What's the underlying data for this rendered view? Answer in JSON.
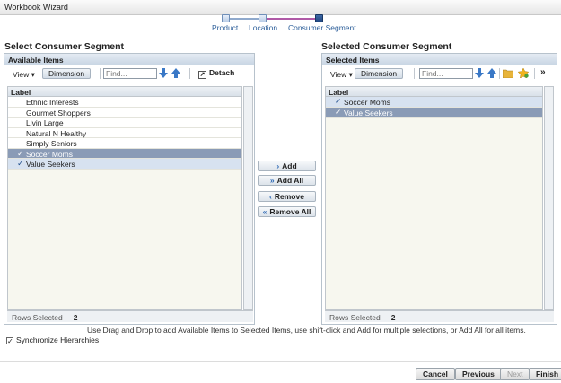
{
  "window": {
    "title": "Workbook Wizard"
  },
  "train": {
    "steps": [
      {
        "label": "Product"
      },
      {
        "label": "Location"
      },
      {
        "label": "Consumer Segment"
      }
    ],
    "current_index": 2
  },
  "left": {
    "section_title": "Select Consumer Segment",
    "panel_title": "Available Items",
    "toolbar": {
      "view_label": "View",
      "dimension_label": "Dimension",
      "find_placeholder": "Find...",
      "detach_label": "Detach"
    },
    "column_header": "Label",
    "items": [
      {
        "label": "Ethnic Interests",
        "checked": false,
        "state": "normal"
      },
      {
        "label": "Gourmet Shoppers",
        "checked": false,
        "state": "normal"
      },
      {
        "label": "Livin Large",
        "checked": false,
        "state": "normal"
      },
      {
        "label": "Natural N Healthy",
        "checked": false,
        "state": "normal"
      },
      {
        "label": "Simply Seniors",
        "checked": false,
        "state": "normal"
      },
      {
        "label": "Soccer Moms",
        "checked": true,
        "state": "selected"
      },
      {
        "label": "Value Seekers",
        "checked": true,
        "state": "highlight"
      }
    ],
    "rows_selected_label": "Rows Selected",
    "rows_selected_count": "2"
  },
  "shuttle": {
    "add": "Add",
    "add_all": "Add All",
    "remove": "Remove",
    "remove_all": "Remove All"
  },
  "right": {
    "section_title": "Selected Consumer Segment",
    "panel_title": "Selected Items",
    "toolbar": {
      "view_label": "View",
      "dimension_label": "Dimension",
      "find_placeholder": "Find...",
      "more_label": "»"
    },
    "column_header": "Label",
    "items": [
      {
        "label": "Soccer Moms",
        "checked": true,
        "state": "highlight"
      },
      {
        "label": "Value Seekers",
        "checked": true,
        "state": "selected"
      }
    ],
    "rows_selected_label": "Rows Selected",
    "rows_selected_count": "2"
  },
  "hint": "Use Drag and Drop to add Available Items to Selected Items, use shift-click and Add for multiple selections, or Add All for all items.",
  "sync_label": "Synchronize Hierarchies",
  "sync_checked": true,
  "buttons": {
    "cancel": "Cancel",
    "previous": "Previous",
    "next": "Next",
    "finish": "Finish"
  }
}
